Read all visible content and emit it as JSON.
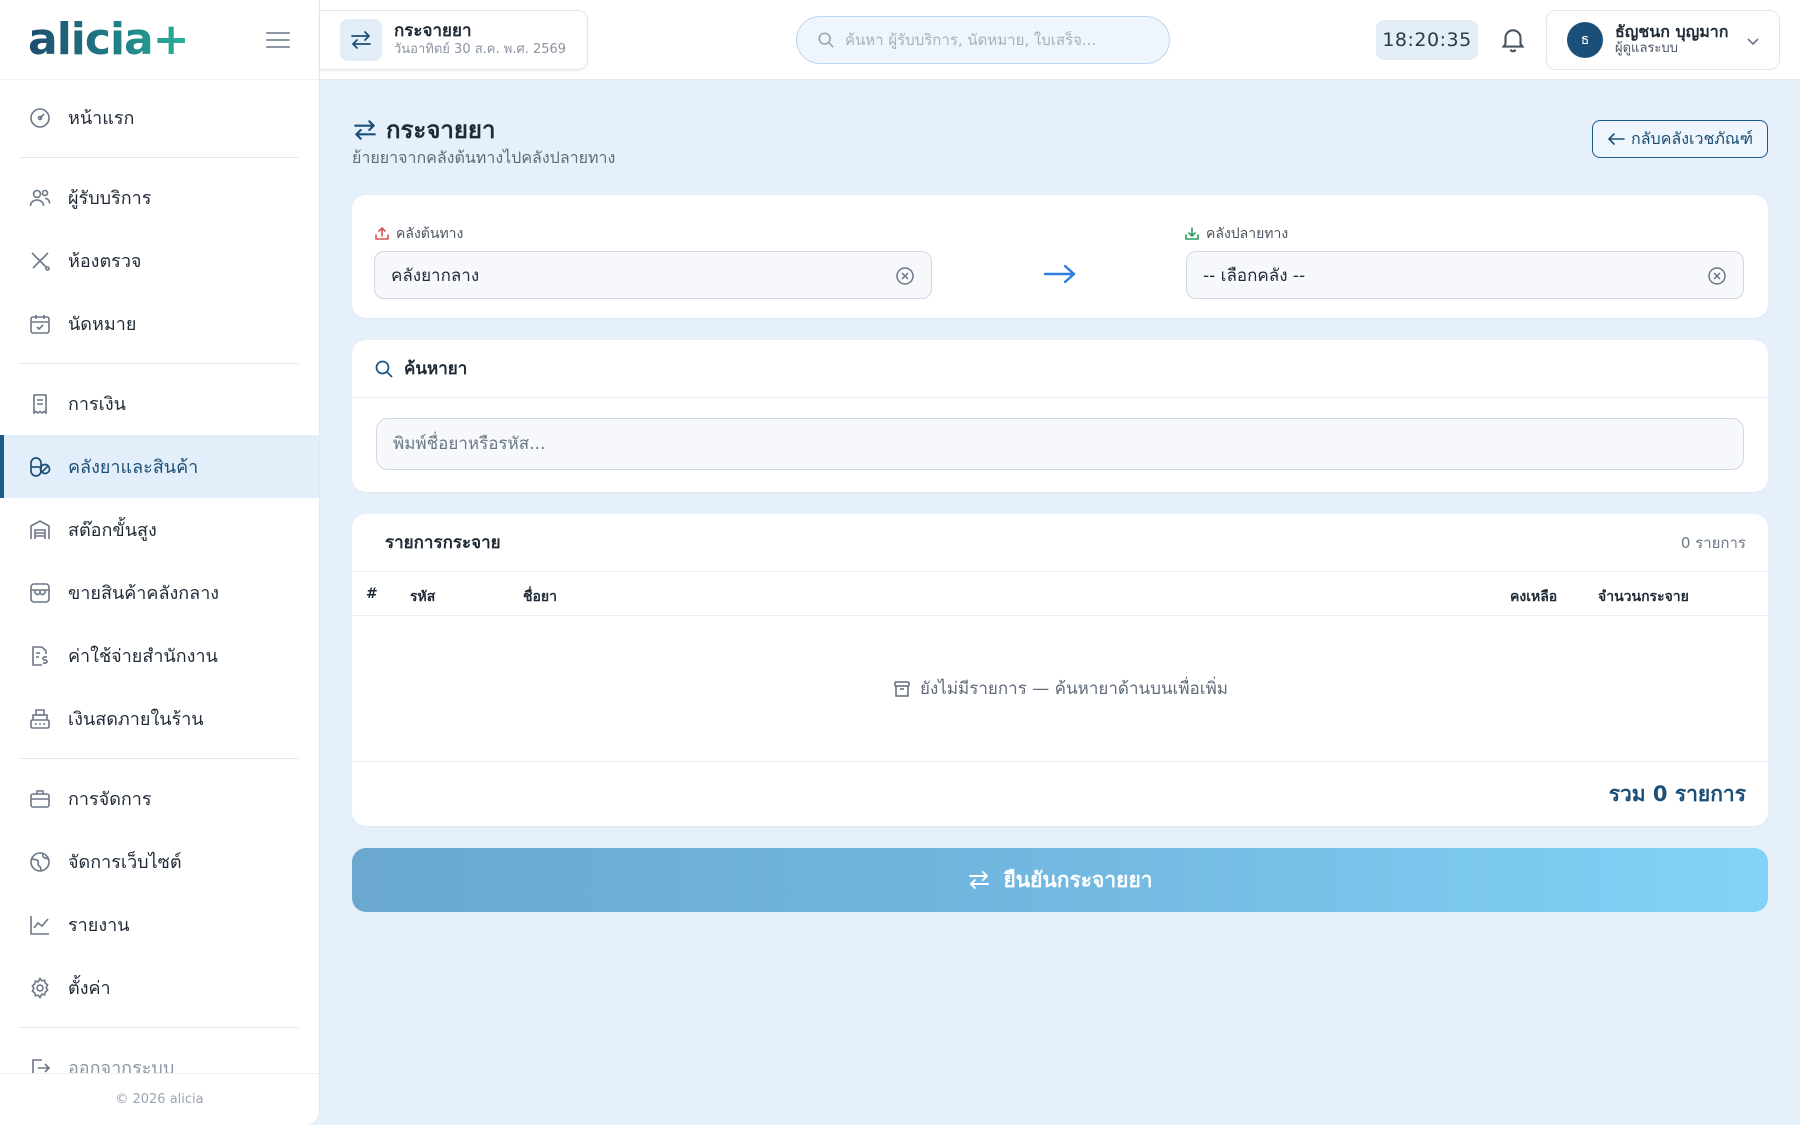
{
  "brand": {
    "logo_text": "alicia+"
  },
  "sidebar": {
    "items": [
      {
        "label": "หน้าแรก",
        "icon": "dashboard-gauge-icon"
      },
      {
        "label": "ผู้รับบริการ",
        "icon": "users-icon"
      },
      {
        "label": "ห้องตรวจ",
        "icon": "stethoscope-icon"
      },
      {
        "label": "นัดหมาย",
        "icon": "calendar-check-icon"
      },
      {
        "label": "การเงิน",
        "icon": "receipt-icon"
      },
      {
        "label": "คลังยาและสินค้า",
        "icon": "pills-icon",
        "active": true
      },
      {
        "label": "สต๊อกขั้นสูง",
        "icon": "warehouse-icon"
      },
      {
        "label": "ขายสินค้าคลังกลาง",
        "icon": "store-icon"
      },
      {
        "label": "ค่าใช้จ่ายสำนักงาน",
        "icon": "expense-icon"
      },
      {
        "label": "เงินสดภายในร้าน",
        "icon": "cash-register-icon"
      },
      {
        "label": "การจัดการ",
        "icon": "briefcase-icon"
      },
      {
        "label": "จัดการเว็บไซต์",
        "icon": "globe-icon"
      },
      {
        "label": "รายงาน",
        "icon": "chart-line-icon"
      },
      {
        "label": "ตั้งค่า",
        "icon": "gear-icon"
      }
    ],
    "logout_label": "ออกจากระบบ",
    "footer": "© 2026 alicia"
  },
  "topbar": {
    "page_title": "กระจายยา",
    "page_date": "วันอาทิตย์ 30 ส.ค. พ.ศ. 2569",
    "search_placeholder": "ค้นหา ผู้รับบริการ, นัดหมาย, ใบเสร็จ...",
    "clock": "18:20:35",
    "user": {
      "initial": "ธ",
      "name": "ธัญชนก บุญมาก",
      "role": "ผู้ดูแลระบบ"
    }
  },
  "page": {
    "title": "กระจายยา",
    "subtitle": "ย้ายยาจากคลังต้นทางไปคลังปลายทาง",
    "back_button": "กลับคลังเวชภัณฑ์"
  },
  "warehouse": {
    "source_label": "คลังต้นทาง",
    "source_value": "คลังยากลาง",
    "dest_label": "คลังปลายทาง",
    "dest_value": "-- เลือกคลัง --",
    "colors": {
      "source_icon": "#d9534f",
      "dest_icon": "#2e9b5f",
      "arrow": "#2f7de0"
    }
  },
  "drug_search": {
    "title": "ค้นหายา",
    "placeholder": "พิมพ์ชื่อยาหรือรหัส..."
  },
  "distribution_list": {
    "title": "รายการกระจาย",
    "count": "0 รายการ",
    "columns": [
      "#",
      "รหัส",
      "ชื่อยา",
      "คงเหลือ",
      "จำนวนกระจาย"
    ],
    "empty_text": "ยังไม่มีรายการ — ค้นหายาด้านบนเพื่อเพิ่ม",
    "total": "รวม 0 รายการ"
  },
  "confirm_button": "ยืนยันกระจายยา"
}
